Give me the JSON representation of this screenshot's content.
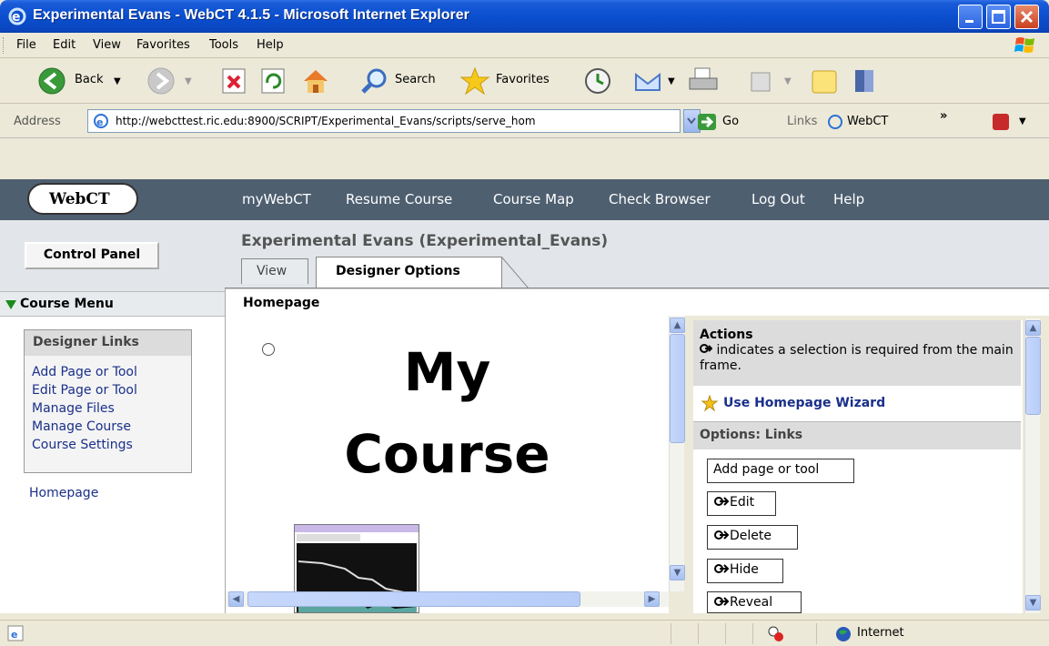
{
  "window": {
    "title": "Experimental Evans - WebCT 4.1.5 - Microsoft Internet Explorer"
  },
  "menu": [
    "File",
    "Edit",
    "View",
    "Favorites",
    "Tools",
    "Help"
  ],
  "toolbar": {
    "back": "Back",
    "search": "Search",
    "favorites": "Favorites"
  },
  "address": {
    "label": "Address",
    "url": "http://webcttest.ric.edu:8900/SCRIPT/Experimental_Evans/scripts/serve_hom",
    "go": "Go",
    "links_label": "Links",
    "links_item": "WebCT"
  },
  "webct": {
    "logo": "WebCT",
    "nav": [
      "myWebCT",
      "Resume Course",
      "Course Map",
      "Check Browser",
      "Log Out",
      "Help"
    ]
  },
  "left": {
    "control_panel": "Control Panel",
    "course_menu": "Course Menu",
    "designer_links_title": "Designer Links",
    "designer_links": [
      "Add Page or Tool",
      "Edit Page or Tool",
      "Manage Files",
      "Manage Course",
      "Course Settings"
    ],
    "homepage": "Homepage"
  },
  "course": {
    "title": "Experimental Evans  (Experimental_Evans)",
    "tabs": [
      "View",
      "Designer Options"
    ],
    "page_label": "Homepage",
    "heading_line1": "My",
    "heading_line2": "Course"
  },
  "actions": {
    "title": "Actions",
    "note": "indicates a selection is required from the main frame.",
    "wizard": "Use Homepage Wizard",
    "options_title": "Options: Links",
    "buttons": [
      "Add page or tool",
      "Edit",
      "Delete",
      "Hide",
      "Reveal"
    ]
  },
  "status": {
    "zone": "Internet"
  }
}
